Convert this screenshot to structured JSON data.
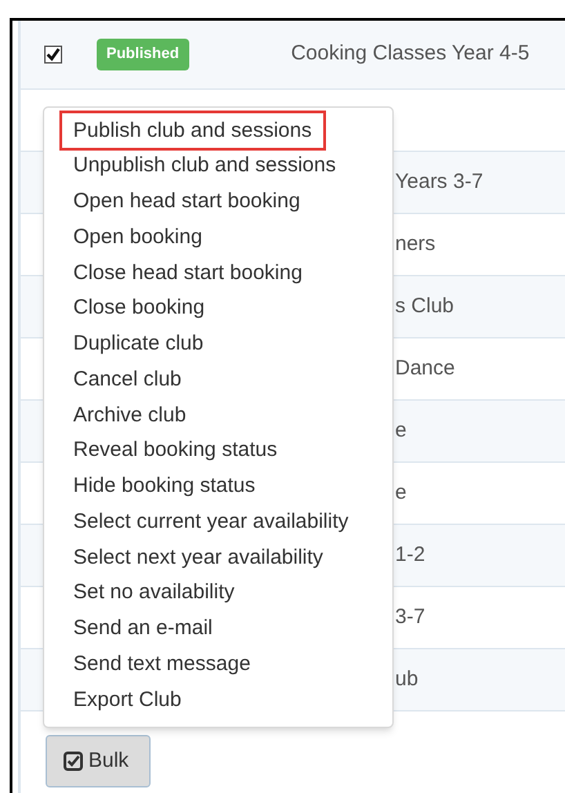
{
  "rows": [
    {
      "checked": true,
      "status": "Published",
      "title": "Cooking Classes Year 4-5"
    },
    {},
    {
      "title": "Years 3-7"
    },
    {
      "title": "ners"
    },
    {
      "title": "s Club"
    },
    {
      "title": "Dance"
    },
    {
      "title": "e"
    },
    {
      "title": "e"
    },
    {
      "title": "1-2"
    },
    {
      "title": "3-7"
    },
    {
      "title": "ub"
    }
  ],
  "menu": {
    "items": [
      {
        "label": "Publish club and sessions",
        "selected": true
      },
      {
        "label": "Unpublish club and sessions",
        "selected": false
      },
      {
        "label": "Open head start booking",
        "selected": false
      },
      {
        "label": "Open booking",
        "selected": false
      },
      {
        "label": "Close head start booking",
        "selected": false
      },
      {
        "label": "Close booking",
        "selected": false
      },
      {
        "label": "Duplicate club",
        "selected": false
      },
      {
        "label": "Cancel club",
        "selected": false
      },
      {
        "label": "Archive club",
        "selected": false
      },
      {
        "label": "Reveal booking status",
        "selected": false
      },
      {
        "label": "Hide booking status",
        "selected": false
      },
      {
        "label": "Select current year availability",
        "selected": false
      },
      {
        "label": "Select next year availability",
        "selected": false
      },
      {
        "label": "Set no availability",
        "selected": false
      },
      {
        "label": "Send an e-mail",
        "selected": false
      },
      {
        "label": "Send text message",
        "selected": false
      },
      {
        "label": "Export Club",
        "selected": false
      }
    ]
  },
  "bulk_button": {
    "label": "Bulk"
  }
}
